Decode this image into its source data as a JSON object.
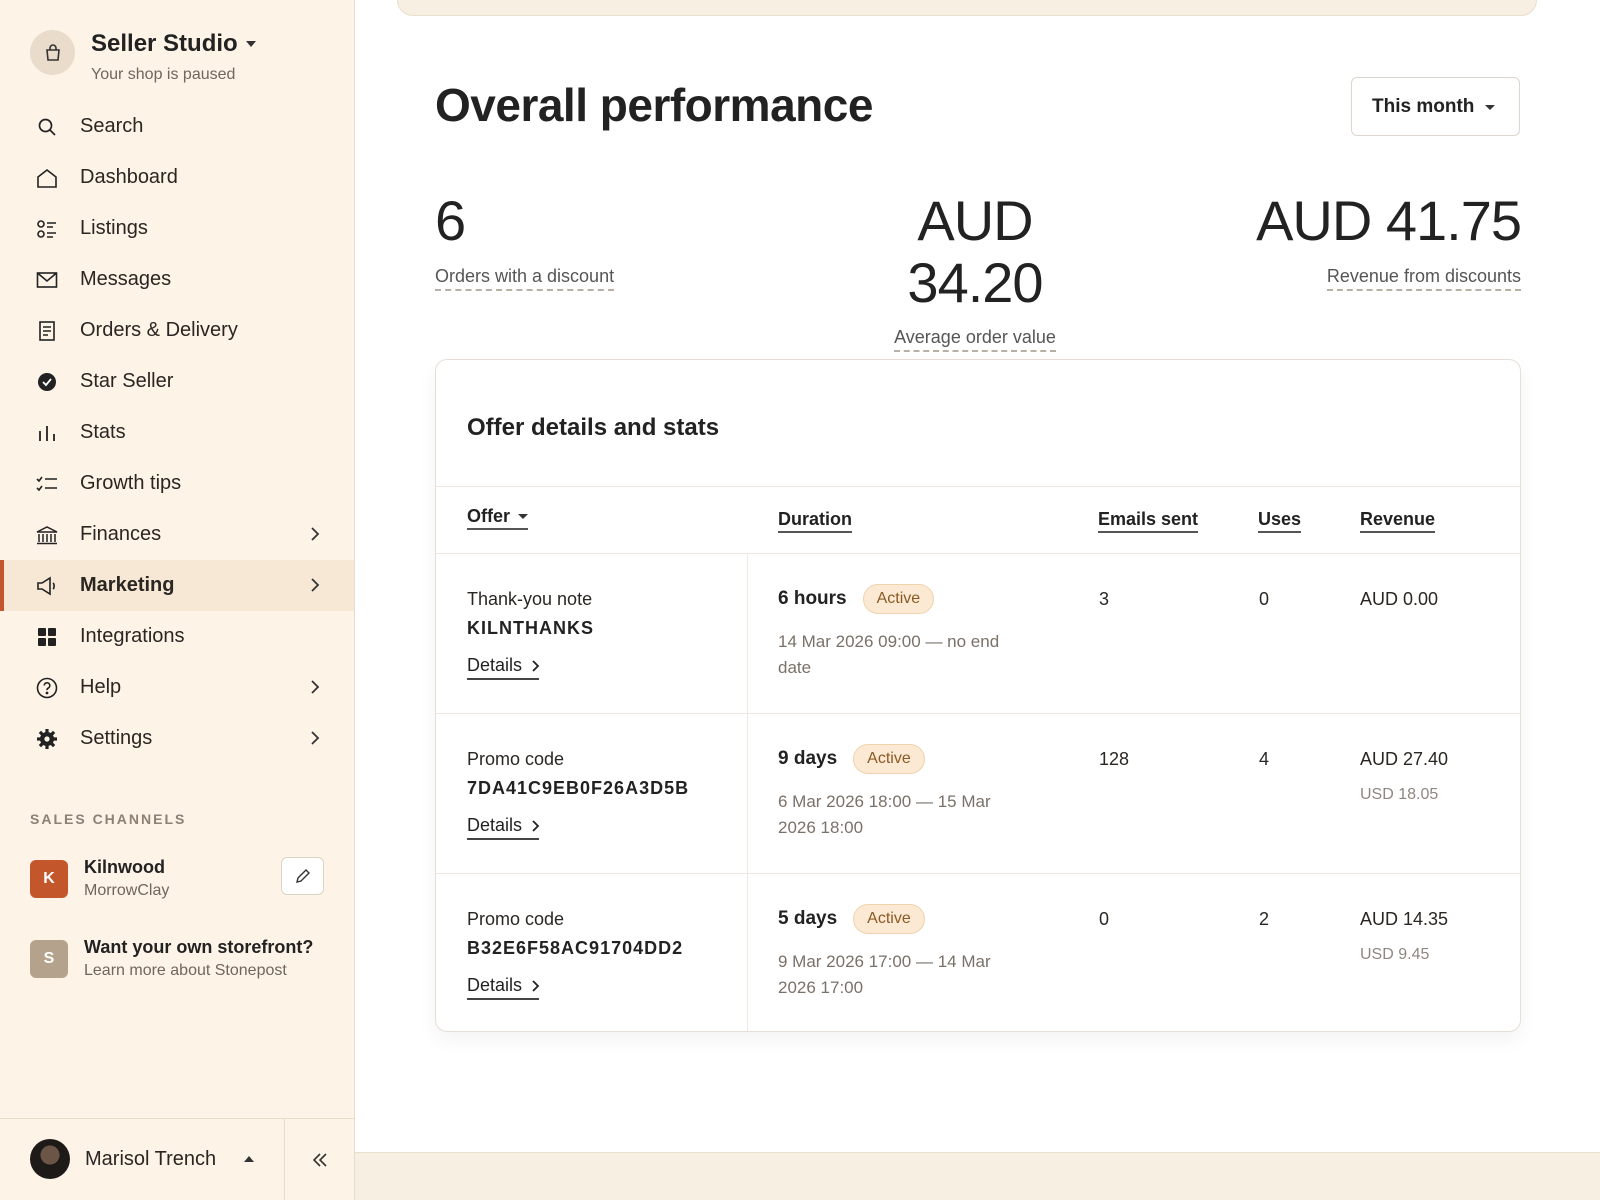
{
  "brand": {
    "title": "Seller Studio",
    "subtitle": "Your shop is paused"
  },
  "nav": [
    {
      "label": "Search",
      "icon": "search-icon"
    },
    {
      "label": "Dashboard",
      "icon": "home-icon"
    },
    {
      "label": "Listings",
      "icon": "listings-icon"
    },
    {
      "label": "Messages",
      "icon": "mail-icon"
    },
    {
      "label": "Orders & Delivery",
      "icon": "clipboard-icon"
    },
    {
      "label": "Star Seller",
      "icon": "star-badge-icon"
    },
    {
      "label": "Stats",
      "icon": "bar-chart-icon"
    },
    {
      "label": "Growth tips",
      "icon": "checklist-icon"
    },
    {
      "label": "Finances",
      "icon": "bank-icon",
      "chevron": true
    },
    {
      "label": "Marketing",
      "icon": "megaphone-icon",
      "chevron": true,
      "active": true
    },
    {
      "label": "Integrations",
      "icon": "grid-icon"
    },
    {
      "label": "Help",
      "icon": "help-icon",
      "chevron": true
    },
    {
      "label": "Settings",
      "icon": "gear-icon",
      "chevron": true
    }
  ],
  "sales_channels": {
    "label": "SALES CHANNELS",
    "primary": {
      "badge": "K",
      "title": "Kilnwood",
      "subtitle": "MorrowClay",
      "color": "#c4562b"
    },
    "promo": {
      "badge": "S",
      "title": "Want your own storefront?",
      "subtitle": "Learn more about Stonepost",
      "color": "#b4a28c"
    }
  },
  "user": {
    "name": "Marisol Trench"
  },
  "main": {
    "title": "Overall performance",
    "range": "This month",
    "metrics": [
      {
        "value": "6",
        "label": "Orders with a discount"
      },
      {
        "value": "AUD 34.20",
        "label": "Average order value"
      },
      {
        "value": "AUD 41.75",
        "label": "Revenue from discounts"
      }
    ]
  },
  "offers": {
    "title": "Offer details and stats",
    "columns": {
      "offer": "Offer",
      "duration": "Duration",
      "emails": "Emails sent",
      "uses": "Uses",
      "revenue": "Revenue"
    },
    "details_label": "Details",
    "rows": [
      {
        "type": "Thank-you note",
        "code": "KILNTHANKS",
        "duration": "6 hours",
        "status": "Active",
        "dates": "14 Mar 2026 09:00 — no end date",
        "emails": "3",
        "uses": "0",
        "revenue": "AUD 0.00",
        "revenue_usd": ""
      },
      {
        "type": "Promo code",
        "code": "7DA41C9EB0F26A3D5B",
        "duration": "9 days",
        "status": "Active",
        "dates": "6 Mar 2026 18:00 — 15 Mar 2026 18:00",
        "emails": "128",
        "uses": "4",
        "revenue": "AUD 27.40",
        "revenue_usd": "USD 18.05"
      },
      {
        "type": "Promo code",
        "code": "B32E6F58AC91704DD2",
        "duration": "5 days",
        "status": "Active",
        "dates": "9 Mar 2026 17:00 — 14 Mar 2026 17:00",
        "emails": "0",
        "uses": "2",
        "revenue": "AUD 14.35",
        "revenue_usd": "USD 9.45"
      }
    ]
  },
  "colors": {
    "accent": "#c4562b",
    "sidebar_bg": "#fdf3e7",
    "active_bg": "#f7e8d6",
    "badge_bg": "#fbe9d3"
  }
}
